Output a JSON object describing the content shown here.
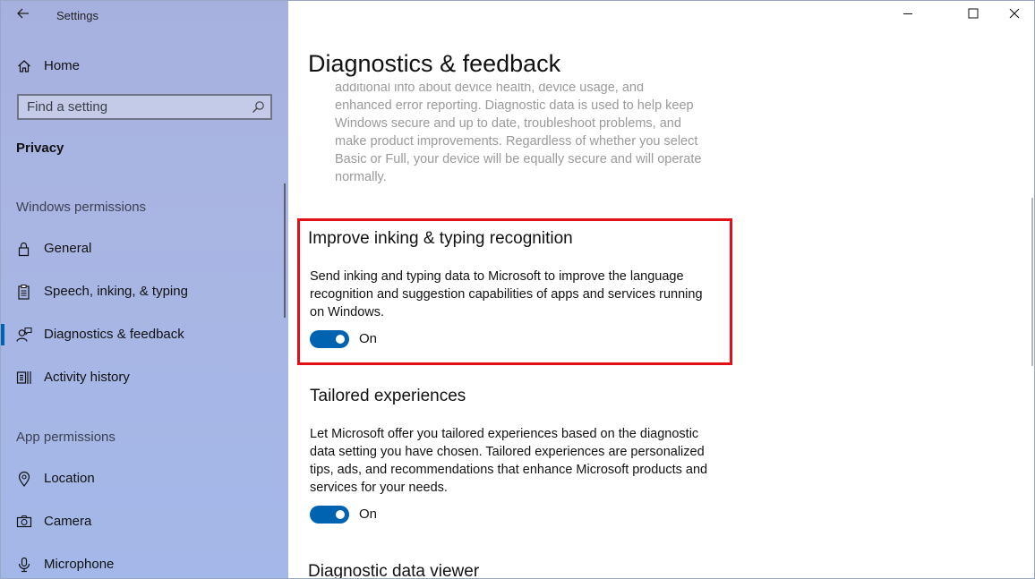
{
  "window": {
    "title": "Settings"
  },
  "sidebar": {
    "home_label": "Home",
    "search_placeholder": "Find a setting",
    "current_section": "Privacy",
    "groups": [
      {
        "header": "Windows permissions",
        "items": [
          {
            "label": "General",
            "icon": "lock-icon"
          },
          {
            "label": "Speech, inking, & typing",
            "icon": "clipboard-icon"
          },
          {
            "label": "Diagnostics & feedback",
            "icon": "person-feedback-icon",
            "active": true
          },
          {
            "label": "Activity history",
            "icon": "activity-history-icon"
          }
        ]
      },
      {
        "header": "App permissions",
        "items": [
          {
            "label": "Location",
            "icon": "location-pin-icon"
          },
          {
            "label": "Camera",
            "icon": "camera-icon"
          },
          {
            "label": "Microphone",
            "icon": "microphone-icon"
          }
        ]
      }
    ]
  },
  "main": {
    "page_title": "Diagnostics & feedback",
    "faded_text_lines": [
      "additional info about device health, device usage, and",
      "enhanced error reporting. Diagnostic data is used to help keep",
      "Windows secure and up to date, troubleshoot problems, and",
      "make product improvements. Regardless of whether you select",
      "Basic or Full, your device will be equally secure and will operate",
      "normally."
    ],
    "sections": [
      {
        "title": "Improve inking & typing recognition",
        "description": "Send inking and typing data to Microsoft to improve the language recognition and suggestion capabilities of apps and services running on Windows.",
        "toggle_state": "On",
        "toggle_on": true,
        "highlighted": true
      },
      {
        "title": "Tailored experiences",
        "description": "Let Microsoft offer you tailored experiences based on the diagnostic data setting you have chosen. Tailored experiences are personalized tips, ads, and recommendations that enhance Microsoft products and services for your needs.",
        "toggle_state": "On",
        "toggle_on": true
      },
      {
        "title": "Diagnostic data viewer"
      }
    ]
  },
  "colors": {
    "accent": "#0063b1",
    "highlight_border": "#e3101a",
    "sidebar_bg": "#a9b5e3"
  }
}
